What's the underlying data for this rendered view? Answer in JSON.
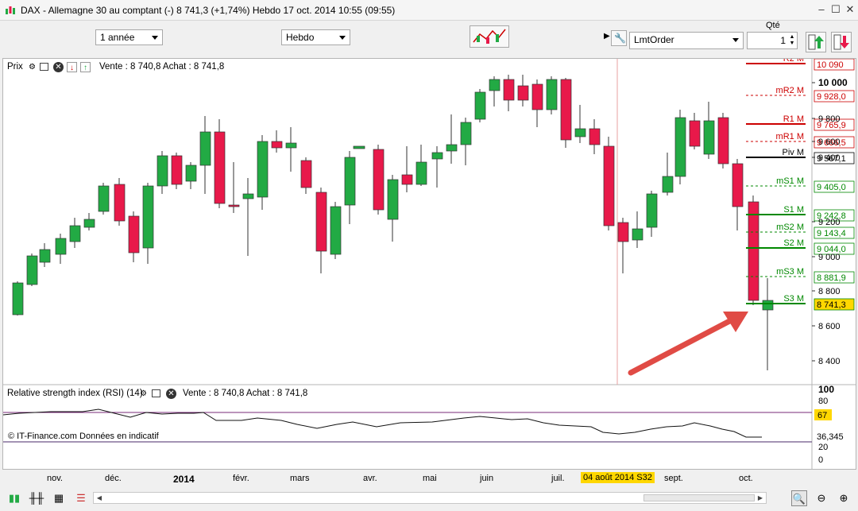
{
  "window": {
    "title": "DAX - Allemagne 30 au comptant (-)    8 741,3 (+1,74%)     Hebdo   17 oct. 2014 10:55 (09:55)",
    "minimize": "–",
    "maximize": "☐",
    "close": "✕"
  },
  "toolbar": {
    "period_select": "1 année",
    "interval_select": "Hebdo",
    "order_type_select": "LmtOrder",
    "qty_label": "Qté",
    "qty_value": "1"
  },
  "price_panel": {
    "title": "Prix",
    "quote": "Vente : 8 740,8 Achat : 8 741,8",
    "source_note": "© IT-Finance.com  Données en indicatif"
  },
  "rsi_panel": {
    "title": "Relative strength index (RSI) (14)",
    "quote": "Vente : 8 740,8 Achat : 8 741,8",
    "current_value": "36,345",
    "level_high": "67",
    "axis": [
      "100",
      "80",
      "20",
      "0"
    ]
  },
  "price_axis": {
    "ticks": [
      "10 000",
      "9 800",
      "9 600",
      "9 400",
      "9 200",
      "9 000",
      "8 800",
      "8 600",
      "8 400"
    ],
    "current_price": "8 741,3"
  },
  "pivots": [
    {
      "name": "R2 M",
      "value": "10 090",
      "color": "#cc0000",
      "style": "solid"
    },
    {
      "name": "mR2 M",
      "value": "9 928,0",
      "color": "#cc0000",
      "style": "dashed"
    },
    {
      "name": "R1 M",
      "value": "9 765,9",
      "color": "#cc0000",
      "style": "solid"
    },
    {
      "name": "mR1 M",
      "value": "9 666,5",
      "color": "#cc0000",
      "style": "dashed"
    },
    {
      "name": "Piv M",
      "value": "9 567,1",
      "color": "#000000",
      "style": "solid"
    },
    {
      "name": "mS1 M",
      "value": "9 405,0",
      "color": "#008800",
      "style": "dashed"
    },
    {
      "name": "S1 M",
      "value": "9 242,8",
      "color": "#008800",
      "style": "solid"
    },
    {
      "name": "mS2 M",
      "value": "9 143,4",
      "color": "#008800",
      "style": "dashed"
    },
    {
      "name": "S2 M",
      "value": "9 044,0",
      "color": "#008800",
      "style": "solid"
    },
    {
      "name": "mS3 M",
      "value": "8 881,9",
      "color": "#008800",
      "style": "dashed"
    },
    {
      "name": "S3 M",
      "value": "8 741,3",
      "color": "#008800",
      "style": "solid"
    }
  ],
  "x_axis": {
    "months": [
      "nov.",
      "déc.",
      "2014",
      "févr.",
      "mars",
      "avr.",
      "mai",
      "juin",
      "juil.",
      "sept.",
      "oct."
    ],
    "cursor_date": "04 août 2014 S32"
  },
  "colors": {
    "up": "#22aa44",
    "down": "#e8194a",
    "arrow": "#e04b45"
  }
}
